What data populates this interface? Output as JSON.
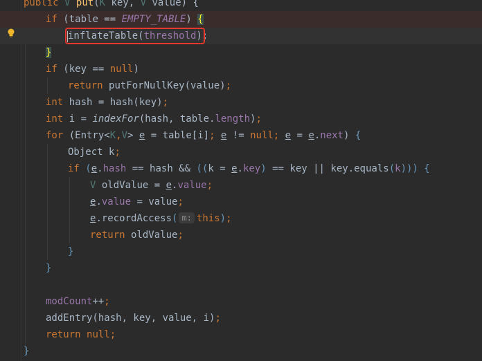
{
  "editor": {
    "lines": [
      {
        "tokens": [
          {
            "t": "public ",
            "c": "kw"
          },
          {
            "t": "V",
            "c": "tp"
          },
          {
            "t": " ",
            "c": ""
          },
          {
            "t": "put",
            "c": "mth"
          },
          {
            "t": "(",
            "c": ""
          },
          {
            "t": "K",
            "c": "tp"
          },
          {
            "t": " key, ",
            "c": ""
          },
          {
            "t": "V",
            "c": "tp"
          },
          {
            "t": " value) {",
            "c": ""
          }
        ]
      },
      {
        "tokens": [
          {
            "t": "if ",
            "c": "kw"
          },
          {
            "t": "(table == ",
            "c": ""
          },
          {
            "t": "EMPTY_TABLE",
            "c": "cst"
          },
          {
            "t": ") ",
            "c": ""
          },
          {
            "t": "{",
            "c": "brace-match"
          }
        ]
      },
      {
        "tokens": [
          {
            "t": "inflateTable",
            "c": ""
          },
          {
            "t": "(",
            "c": ""
          },
          {
            "t": "threshold",
            "c": "fld"
          },
          {
            "t": ");",
            "c": ""
          }
        ]
      },
      {
        "tokens": [
          {
            "t": "}",
            "c": "brace-match"
          }
        ]
      },
      {
        "tokens": [
          {
            "t": "if ",
            "c": "kw"
          },
          {
            "t": "(key == ",
            "c": ""
          },
          {
            "t": "null",
            "c": "kw"
          },
          {
            "t": ")",
            "c": ""
          }
        ]
      },
      {
        "tokens": [
          {
            "t": "return ",
            "c": "kw"
          },
          {
            "t": "putForNullKey(value)",
            "c": ""
          },
          {
            "t": ";",
            "c": "kw"
          }
        ]
      },
      {
        "tokens": [
          {
            "t": "int ",
            "c": "kw"
          },
          {
            "t": "hash = hash(key)",
            "c": ""
          },
          {
            "t": ";",
            "c": "kw"
          }
        ]
      },
      {
        "tokens": [
          {
            "t": "int ",
            "c": "kw"
          },
          {
            "t": "i = ",
            "c": ""
          },
          {
            "t": "indexFor",
            "c": "stat"
          },
          {
            "t": "(hash, table.",
            "c": ""
          },
          {
            "t": "length",
            "c": "fld"
          },
          {
            "t": ")",
            "c": ""
          },
          {
            "t": ";",
            "c": "kw"
          }
        ]
      },
      {
        "tokens": [
          {
            "t": "for ",
            "c": "kw"
          },
          {
            "t": "(Entry<",
            "c": ""
          },
          {
            "t": "K",
            "c": "tp"
          },
          {
            "t": ",",
            "c": "kw"
          },
          {
            "t": "V",
            "c": "tp"
          },
          {
            "t": "> ",
            "c": ""
          },
          {
            "t": "e",
            "c": "ul"
          },
          {
            "t": " = table[i]",
            "c": ""
          },
          {
            "t": "; ",
            "c": "kw"
          },
          {
            "t": "e",
            "c": "ul"
          },
          {
            "t": " != ",
            "c": ""
          },
          {
            "t": "null",
            "c": "kw"
          },
          {
            "t": "; ",
            "c": "kw"
          },
          {
            "t": "e",
            "c": "ul"
          },
          {
            "t": " = ",
            "c": ""
          },
          {
            "t": "e",
            "c": "ul"
          },
          {
            "t": ".",
            "c": ""
          },
          {
            "t": "next",
            "c": "fld"
          },
          {
            "t": ") ",
            "c": ""
          },
          {
            "t": "{",
            "c": "brace-match-blue"
          }
        ]
      },
      {
        "tokens": [
          {
            "t": "Object k",
            "c": ""
          },
          {
            "t": ";",
            "c": "kw"
          }
        ]
      },
      {
        "tokens": [
          {
            "t": "if ",
            "c": "kw"
          },
          {
            "t": "(",
            "c": "brace-match-blue"
          },
          {
            "t": "e",
            "c": "ul"
          },
          {
            "t": ".",
            "c": ""
          },
          {
            "t": "hash",
            "c": "fld"
          },
          {
            "t": " == hash && ",
            "c": ""
          },
          {
            "t": "((",
            "c": "brace-match-blue"
          },
          {
            "t": "k = ",
            "c": ""
          },
          {
            "t": "e",
            "c": "ul"
          },
          {
            "t": ".",
            "c": ""
          },
          {
            "t": "key",
            "c": "fld"
          },
          {
            "t": ")",
            "c": "brace-match-blue"
          },
          {
            "t": " == key || key.equals",
            "c": ""
          },
          {
            "t": "(",
            "c": "brace-match-blue"
          },
          {
            "t": "k",
            "c": "fld"
          },
          {
            "t": ")))",
            "c": "brace-match-blue"
          },
          {
            "t": " ",
            "c": ""
          },
          {
            "t": "{",
            "c": "brace-match-blue"
          }
        ]
      },
      {
        "tokens": [
          {
            "t": "V",
            "c": "tp"
          },
          {
            "t": " oldValue = ",
            "c": ""
          },
          {
            "t": "e",
            "c": "ul"
          },
          {
            "t": ".",
            "c": ""
          },
          {
            "t": "value",
            "c": "fld"
          },
          {
            "t": ";",
            "c": "kw"
          }
        ]
      },
      {
        "tokens": [
          {
            "t": "e",
            "c": "ul"
          },
          {
            "t": ".",
            "c": ""
          },
          {
            "t": "value",
            "c": "fld"
          },
          {
            "t": " = value",
            "c": ""
          },
          {
            "t": ";",
            "c": "kw"
          }
        ]
      },
      {
        "tokens": [
          {
            "t": "e",
            "c": "ul"
          },
          {
            "t": ".recordAccess",
            "c": ""
          },
          {
            "t": "(",
            "c": "brace-match-blue"
          },
          {
            "t": "m:",
            "c": "hint"
          },
          {
            "t": "this",
            "c": "kw"
          },
          {
            "t": ")",
            "c": "brace-match-blue"
          },
          {
            "t": ";",
            "c": "kw"
          }
        ]
      },
      {
        "tokens": [
          {
            "t": "return ",
            "c": "kw"
          },
          {
            "t": "oldValue",
            "c": ""
          },
          {
            "t": ";",
            "c": "kw"
          }
        ]
      },
      {
        "tokens": [
          {
            "t": "}",
            "c": "brace-match-blue"
          }
        ]
      },
      {
        "tokens": [
          {
            "t": "}",
            "c": "brace-match-blue"
          }
        ]
      },
      {
        "tokens": []
      },
      {
        "tokens": [
          {
            "t": "modCount",
            "c": "fld"
          },
          {
            "t": "++",
            "c": ""
          },
          {
            "t": ";",
            "c": "kw"
          }
        ]
      },
      {
        "tokens": [
          {
            "t": "addEntry(hash, key, value, i)",
            "c": ""
          },
          {
            "t": ";",
            "c": "kw"
          }
        ]
      },
      {
        "tokens": [
          {
            "t": "return ",
            "c": "kw"
          },
          {
            "t": "null",
            "c": "kw"
          },
          {
            "t": ";",
            "c": "kw"
          }
        ]
      },
      {
        "tokens": [
          {
            "t": "}",
            "c": "brace-match-blue"
          }
        ]
      }
    ]
  },
  "gutter": {
    "intention_icon": "lightbulb-icon"
  },
  "colors": {
    "background": "#2b2b2b",
    "keyword": "#cc7832",
    "field": "#9876aa",
    "method": "#ffc66d",
    "text": "#a9b7c6",
    "highlight_border": "#e8372c"
  }
}
